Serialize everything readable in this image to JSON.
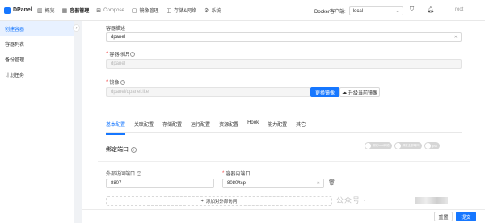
{
  "app": {
    "name": "DPanel"
  },
  "nav": [
    {
      "label": "概览",
      "icon": "chart-icon",
      "glyph": "▥",
      "active": false,
      "muted": false
    },
    {
      "label": "容器管理",
      "icon": "grid-icon",
      "glyph": "▦",
      "active": true,
      "muted": false
    },
    {
      "label": "Compose",
      "icon": "compose-icon",
      "glyph": "⊞",
      "active": false,
      "muted": true
    },
    {
      "label": "镜像管理",
      "icon": "image-icon",
      "glyph": "▢",
      "active": false,
      "muted": false
    },
    {
      "label": "存储&网络",
      "icon": "storage-icon",
      "glyph": "◫",
      "active": false,
      "muted": false
    },
    {
      "label": "系统",
      "icon": "gear-icon",
      "glyph": "⚙",
      "active": false,
      "muted": false
    }
  ],
  "docker": {
    "label": "Docker客户端:",
    "value": "local"
  },
  "user": {
    "name": "root"
  },
  "sidebar": {
    "items": [
      {
        "label": "创建容器",
        "active": true
      },
      {
        "label": "容器列表",
        "active": false
      },
      {
        "label": "备份管理",
        "active": false
      },
      {
        "label": "计划任务",
        "active": false
      }
    ]
  },
  "form": {
    "description": {
      "label": "容器描述",
      "value": "dpanel"
    },
    "identifier": {
      "label": "容器标识",
      "value": "dpanel"
    },
    "image": {
      "label": "镜像",
      "value": "dpanel/dpanel:lite",
      "change_button": "更换镜像",
      "upgrade_button": "升级当前镜像"
    }
  },
  "tabs": [
    {
      "label": "基本配置",
      "active": true
    },
    {
      "label": "关联配置",
      "active": false
    },
    {
      "label": "存储配置",
      "active": false
    },
    {
      "label": "运行配置",
      "active": false
    },
    {
      "label": "资源配置",
      "active": false
    },
    {
      "label": "Hook",
      "active": false
    },
    {
      "label": "能力配置",
      "active": false
    },
    {
      "label": "其它",
      "active": false
    }
  ],
  "ports": {
    "title": "绑定端口",
    "toggles": [
      "绑定host网络",
      "绑定全部端口",
      "ipv6"
    ],
    "external_label": "外部访问端口",
    "external_value": "8807",
    "internal_label": "容器内端口",
    "internal_value": "8080/tcp",
    "add_label": "添加对外部访问"
  },
  "watermark": {
    "text": "公众号 ·"
  },
  "footer": {
    "reset_label": "重置",
    "submit_label": "提交"
  }
}
